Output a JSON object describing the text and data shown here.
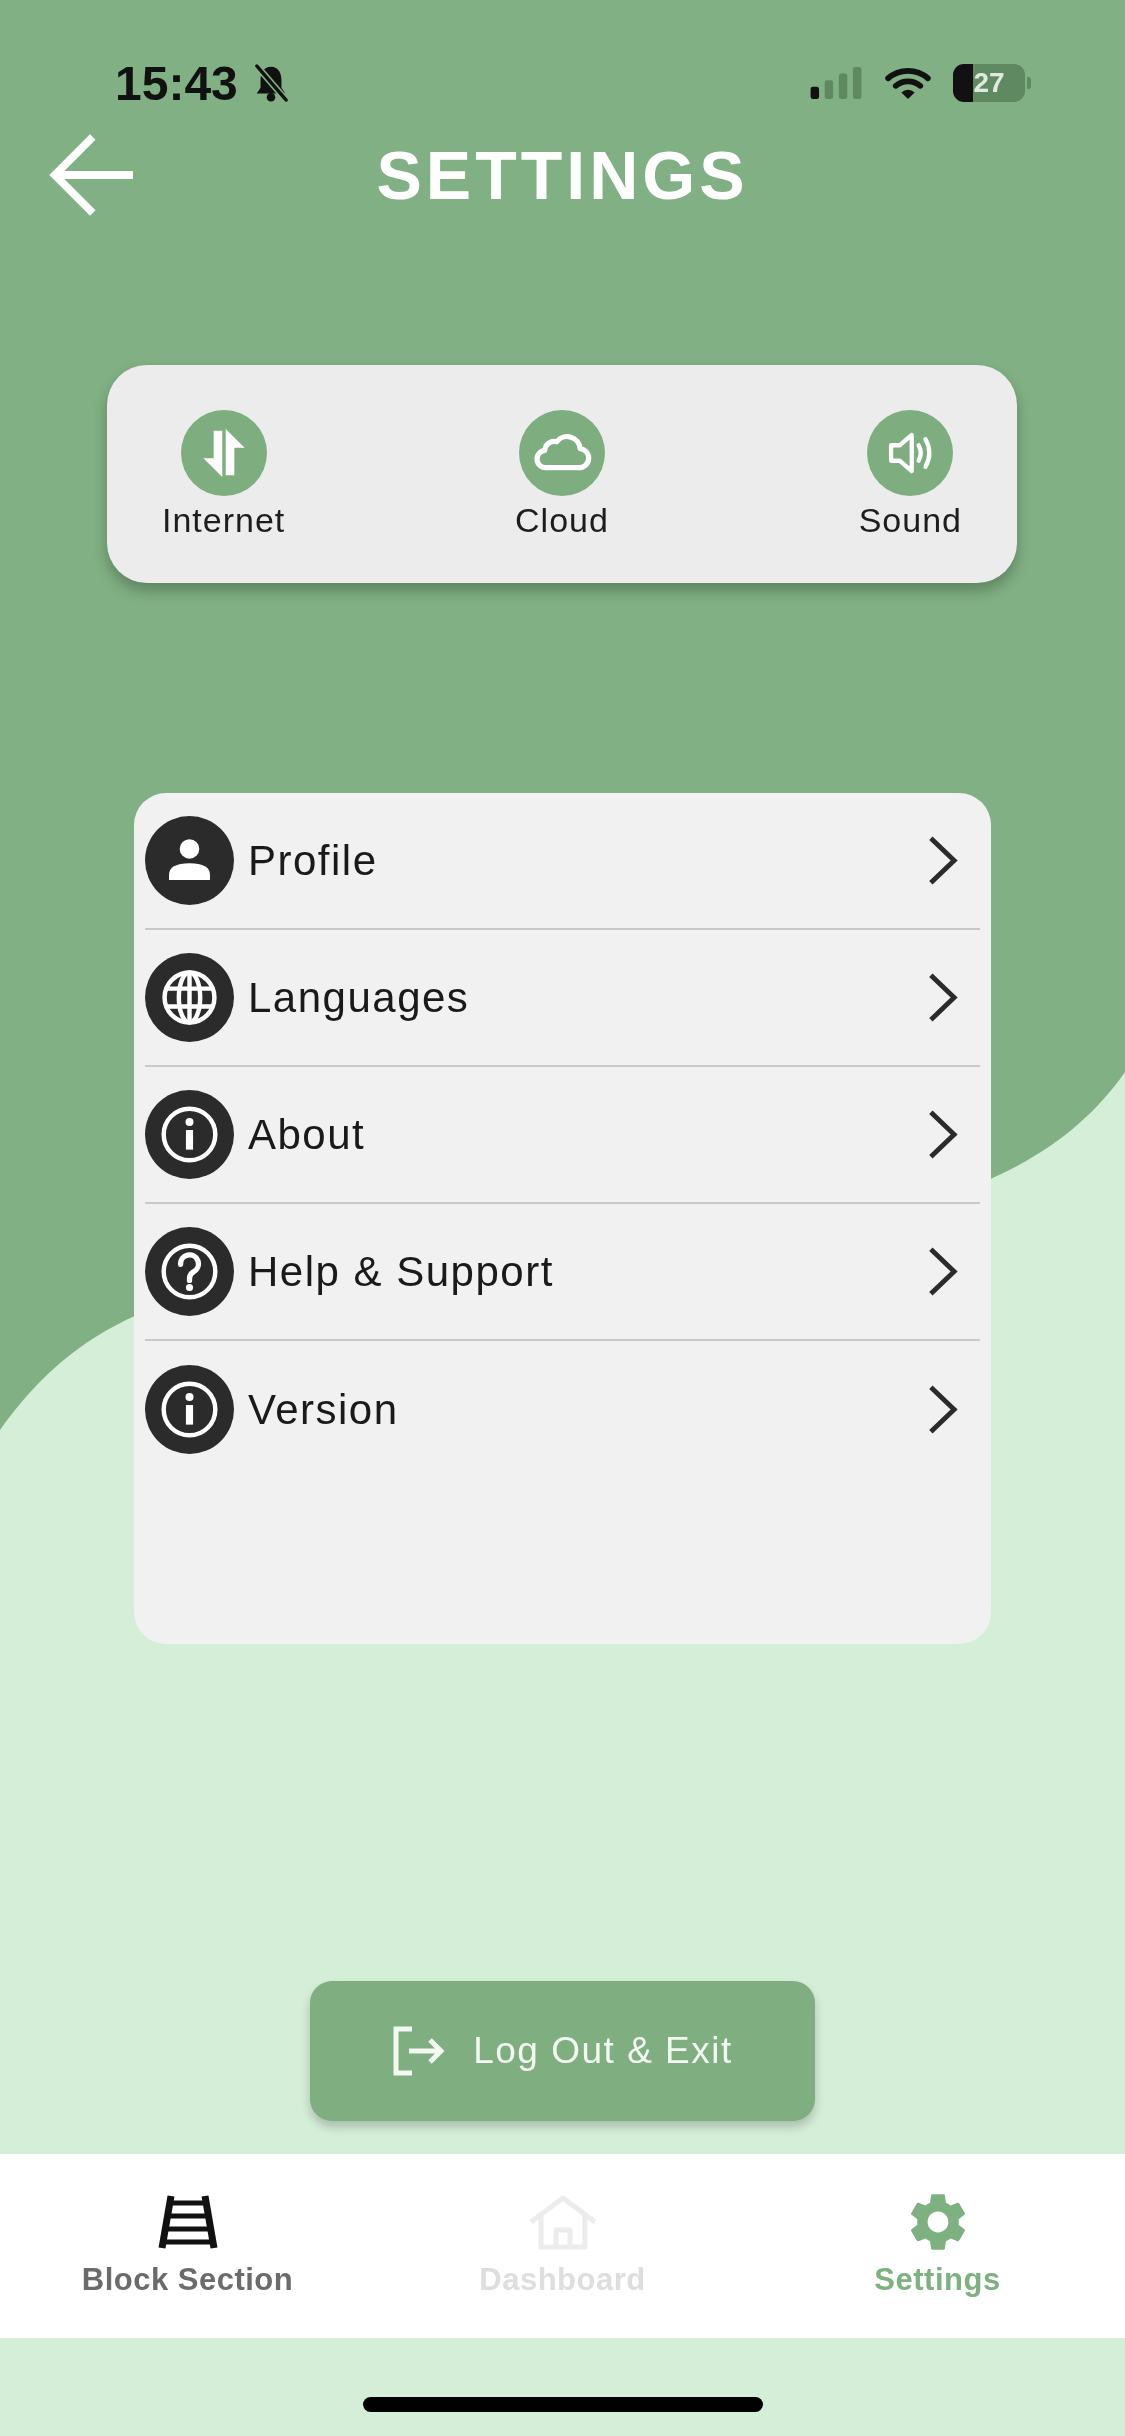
{
  "status_bar": {
    "time": "15:43",
    "battery": "27"
  },
  "header": {
    "title": "SETTINGS"
  },
  "quick_actions": [
    {
      "label": "Internet"
    },
    {
      "label": "Cloud"
    },
    {
      "label": "Sound"
    }
  ],
  "menu": [
    {
      "label": "Profile"
    },
    {
      "label": "Languages"
    },
    {
      "label": "About"
    },
    {
      "label": "Help & Support"
    },
    {
      "label": "Version"
    }
  ],
  "logout_button": {
    "label": "Log Out & Exit"
  },
  "tab_bar": [
    {
      "label": "Block Section",
      "selected": false,
      "disabled": false
    },
    {
      "label": "Dashboard",
      "selected": false,
      "disabled": true
    },
    {
      "label": "Settings",
      "selected": true,
      "disabled": false
    }
  ]
}
